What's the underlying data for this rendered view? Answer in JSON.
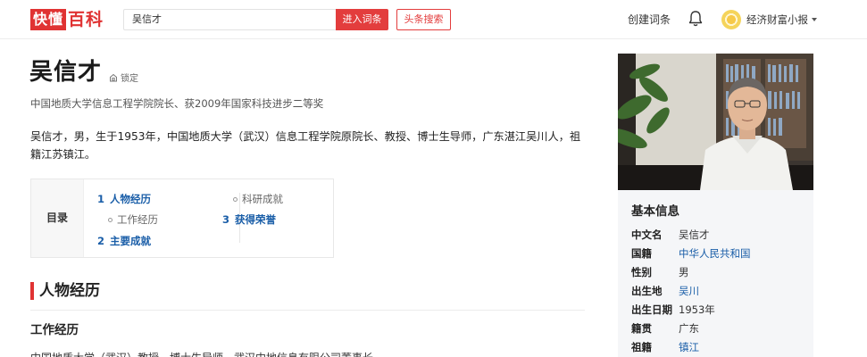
{
  "header": {
    "logo_box": "快懂",
    "logo_text": "百科",
    "search_value": "吴信才",
    "enter_button": "进入词条",
    "toutiao_button": "头条搜索",
    "create_entry": "创建词条",
    "username": "经济财富小报"
  },
  "entry": {
    "title": "吴信才",
    "lock_label": "锁定",
    "subtitle": "中国地质大学信息工程学院院长、获2009年国家科技进步二等奖",
    "summary": "吴信才，男，生于1953年，中国地质大学（武汉）信息工程学院原院长、教授、博士生导师，广东湛江吴川人，祖籍江苏镇江。"
  },
  "toc": {
    "label": "目录",
    "items": [
      {
        "num": "1",
        "text": "人物经历"
      },
      {
        "text": "工作经历"
      },
      {
        "num": "2",
        "text": "主要成就"
      },
      {
        "text": "科研成就"
      },
      {
        "num": "3",
        "text": "获得荣誉"
      }
    ]
  },
  "section": {
    "title": "人物经历",
    "subtitle": "工作经历",
    "text": "中国地质大学（武汉）教授，博士生导师，武汉中地信息有限公司董事长"
  },
  "infobox": {
    "title": "基本信息",
    "rows": [
      {
        "key": "中文名",
        "value": "吴信才"
      },
      {
        "key": "国籍",
        "value": "中华人民共和国"
      },
      {
        "key": "性别",
        "value": "男"
      },
      {
        "key": "出生地",
        "value": "吴川"
      },
      {
        "key": "出生日期",
        "value": "1953年"
      },
      {
        "key": "籍贯",
        "value": "广东"
      },
      {
        "key": "祖籍",
        "value": "镇江"
      }
    ]
  },
  "colors": {
    "accent": "#e33d3d",
    "link": "#1a5ea8"
  },
  "icons": [
    "bell-icon",
    "lock-icon",
    "caret-down-icon",
    "avatar"
  ]
}
